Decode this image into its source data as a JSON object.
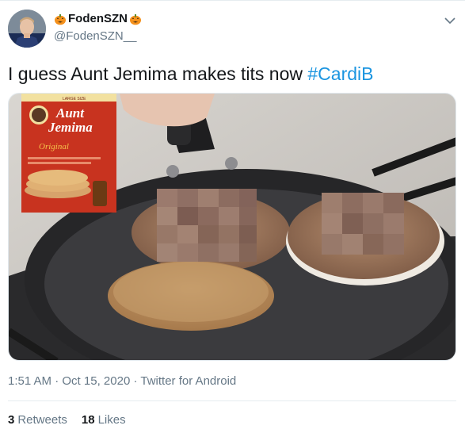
{
  "tweet": {
    "display_name": "FodenSZN",
    "handle": "@FodenSZN__",
    "text_plain": "I guess Aunt Jemima makes tits now ",
    "hashtag": "#CardiB",
    "time": "1:51 AM",
    "date": "Oct 15, 2020",
    "source": "Twitter for Android",
    "separator": "·"
  },
  "stats": {
    "retweets_count": "3",
    "retweets_label": "Retweets",
    "likes_count": "18",
    "likes_label": "Likes"
  },
  "media": {
    "box_brand_line1": "Aunt",
    "box_brand_line2": "Jemima",
    "box_variant": "Original",
    "box_top_text": "LARGE SIZE"
  },
  "colors": {
    "hashtag": "#1b95e0",
    "secondary_text": "#657786",
    "primary_text": "#14171a",
    "pumpkin": "#f5911c"
  },
  "icons": {
    "pumpkin": "pumpkin-emoji",
    "caret": "chevron-down"
  }
}
